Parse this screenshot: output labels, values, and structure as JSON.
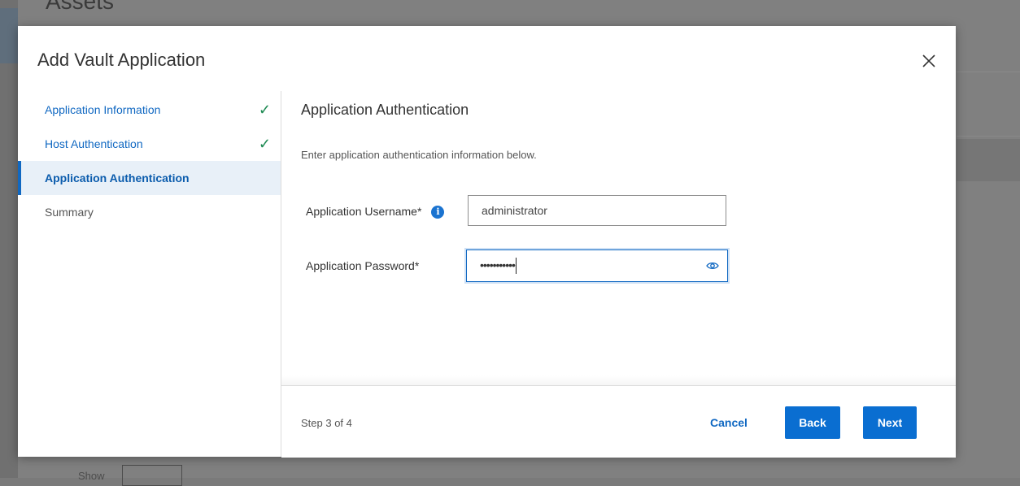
{
  "background": {
    "page_title": "Assets",
    "bottom_label": "Show"
  },
  "modal": {
    "title": "Add Vault Application",
    "close_icon": "close-icon"
  },
  "nav": {
    "items": [
      {
        "label": "Application Information",
        "state": "complete"
      },
      {
        "label": "Host Authentication",
        "state": "complete"
      },
      {
        "label": "Application Authentication",
        "state": "active"
      },
      {
        "label": "Summary",
        "state": "pending"
      }
    ]
  },
  "content": {
    "title": "Application Authentication",
    "description": "Enter application authentication information below.",
    "username": {
      "label": "Application Username*",
      "value": "administrator",
      "info_icon": "info-icon"
    },
    "password": {
      "label": "Application Password*",
      "masked_value": "•••••••••••",
      "toggle_icon": "eye-icon"
    }
  },
  "footer": {
    "step": "Step 3 of 4",
    "cancel_label": "Cancel",
    "back_label": "Back",
    "next_label": "Next"
  },
  "colors": {
    "accent": "#0a6ed1",
    "link": "#1068c2",
    "check": "#1d8a52",
    "active_bg": "#e8f0f8"
  }
}
